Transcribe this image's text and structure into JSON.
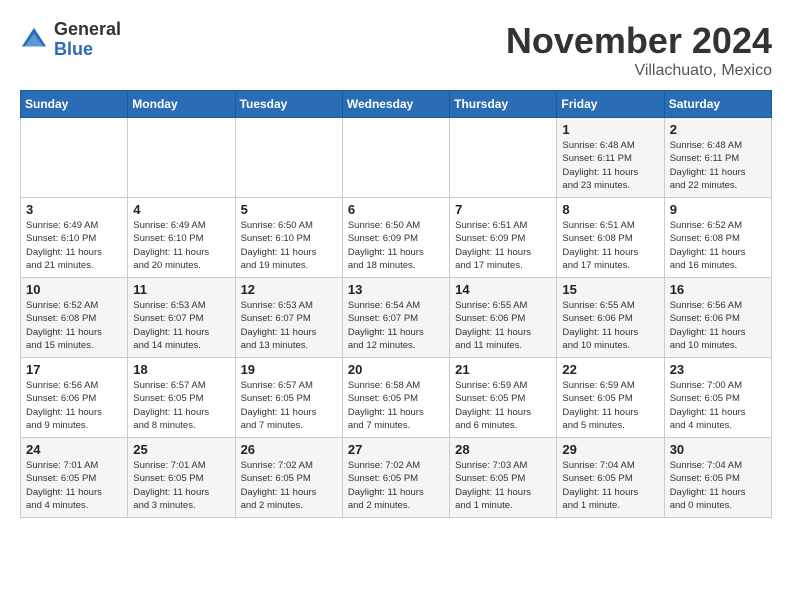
{
  "logo": {
    "general": "General",
    "blue": "Blue"
  },
  "title": "November 2024",
  "location": "Villachuato, Mexico",
  "weekdays": [
    "Sunday",
    "Monday",
    "Tuesday",
    "Wednesday",
    "Thursday",
    "Friday",
    "Saturday"
  ],
  "rows": [
    [
      {
        "day": "",
        "info": ""
      },
      {
        "day": "",
        "info": ""
      },
      {
        "day": "",
        "info": ""
      },
      {
        "day": "",
        "info": ""
      },
      {
        "day": "",
        "info": ""
      },
      {
        "day": "1",
        "info": "Sunrise: 6:48 AM\nSunset: 6:11 PM\nDaylight: 11 hours\nand 23 minutes."
      },
      {
        "day": "2",
        "info": "Sunrise: 6:48 AM\nSunset: 6:11 PM\nDaylight: 11 hours\nand 22 minutes."
      }
    ],
    [
      {
        "day": "3",
        "info": "Sunrise: 6:49 AM\nSunset: 6:10 PM\nDaylight: 11 hours\nand 21 minutes."
      },
      {
        "day": "4",
        "info": "Sunrise: 6:49 AM\nSunset: 6:10 PM\nDaylight: 11 hours\nand 20 minutes."
      },
      {
        "day": "5",
        "info": "Sunrise: 6:50 AM\nSunset: 6:10 PM\nDaylight: 11 hours\nand 19 minutes."
      },
      {
        "day": "6",
        "info": "Sunrise: 6:50 AM\nSunset: 6:09 PM\nDaylight: 11 hours\nand 18 minutes."
      },
      {
        "day": "7",
        "info": "Sunrise: 6:51 AM\nSunset: 6:09 PM\nDaylight: 11 hours\nand 17 minutes."
      },
      {
        "day": "8",
        "info": "Sunrise: 6:51 AM\nSunset: 6:08 PM\nDaylight: 11 hours\nand 17 minutes."
      },
      {
        "day": "9",
        "info": "Sunrise: 6:52 AM\nSunset: 6:08 PM\nDaylight: 11 hours\nand 16 minutes."
      }
    ],
    [
      {
        "day": "10",
        "info": "Sunrise: 6:52 AM\nSunset: 6:08 PM\nDaylight: 11 hours\nand 15 minutes."
      },
      {
        "day": "11",
        "info": "Sunrise: 6:53 AM\nSunset: 6:07 PM\nDaylight: 11 hours\nand 14 minutes."
      },
      {
        "day": "12",
        "info": "Sunrise: 6:53 AM\nSunset: 6:07 PM\nDaylight: 11 hours\nand 13 minutes."
      },
      {
        "day": "13",
        "info": "Sunrise: 6:54 AM\nSunset: 6:07 PM\nDaylight: 11 hours\nand 12 minutes."
      },
      {
        "day": "14",
        "info": "Sunrise: 6:55 AM\nSunset: 6:06 PM\nDaylight: 11 hours\nand 11 minutes."
      },
      {
        "day": "15",
        "info": "Sunrise: 6:55 AM\nSunset: 6:06 PM\nDaylight: 11 hours\nand 10 minutes."
      },
      {
        "day": "16",
        "info": "Sunrise: 6:56 AM\nSunset: 6:06 PM\nDaylight: 11 hours\nand 10 minutes."
      }
    ],
    [
      {
        "day": "17",
        "info": "Sunrise: 6:56 AM\nSunset: 6:06 PM\nDaylight: 11 hours\nand 9 minutes."
      },
      {
        "day": "18",
        "info": "Sunrise: 6:57 AM\nSunset: 6:05 PM\nDaylight: 11 hours\nand 8 minutes."
      },
      {
        "day": "19",
        "info": "Sunrise: 6:57 AM\nSunset: 6:05 PM\nDaylight: 11 hours\nand 7 minutes."
      },
      {
        "day": "20",
        "info": "Sunrise: 6:58 AM\nSunset: 6:05 PM\nDaylight: 11 hours\nand 7 minutes."
      },
      {
        "day": "21",
        "info": "Sunrise: 6:59 AM\nSunset: 6:05 PM\nDaylight: 11 hours\nand 6 minutes."
      },
      {
        "day": "22",
        "info": "Sunrise: 6:59 AM\nSunset: 6:05 PM\nDaylight: 11 hours\nand 5 minutes."
      },
      {
        "day": "23",
        "info": "Sunrise: 7:00 AM\nSunset: 6:05 PM\nDaylight: 11 hours\nand 4 minutes."
      }
    ],
    [
      {
        "day": "24",
        "info": "Sunrise: 7:01 AM\nSunset: 6:05 PM\nDaylight: 11 hours\nand 4 minutes."
      },
      {
        "day": "25",
        "info": "Sunrise: 7:01 AM\nSunset: 6:05 PM\nDaylight: 11 hours\nand 3 minutes."
      },
      {
        "day": "26",
        "info": "Sunrise: 7:02 AM\nSunset: 6:05 PM\nDaylight: 11 hours\nand 2 minutes."
      },
      {
        "day": "27",
        "info": "Sunrise: 7:02 AM\nSunset: 6:05 PM\nDaylight: 11 hours\nand 2 minutes."
      },
      {
        "day": "28",
        "info": "Sunrise: 7:03 AM\nSunset: 6:05 PM\nDaylight: 11 hours\nand 1 minute."
      },
      {
        "day": "29",
        "info": "Sunrise: 7:04 AM\nSunset: 6:05 PM\nDaylight: 11 hours\nand 1 minute."
      },
      {
        "day": "30",
        "info": "Sunrise: 7:04 AM\nSunset: 6:05 PM\nDaylight: 11 hours\nand 0 minutes."
      }
    ]
  ]
}
